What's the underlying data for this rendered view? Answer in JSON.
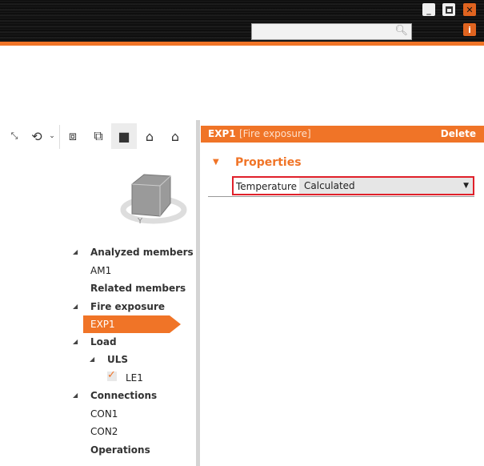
{
  "window": {
    "minimize_icon": "minimize-icon",
    "maximize_icon": "maximize-icon",
    "close_icon": "close-icon",
    "info_label": "i"
  },
  "search": {
    "placeholder": "",
    "value": ""
  },
  "toolbar": {
    "icons": [
      "zoom-extents-icon",
      "rotate-icon",
      "wireframe-view-icon",
      "transparent-view-icon",
      "solid-view-icon",
      "section-view-icon",
      "home-view-icon"
    ]
  },
  "tree": [
    {
      "label": "Analyzed members",
      "bold": true,
      "expander": true
    },
    {
      "label": "AM1"
    },
    {
      "label": "Related members",
      "bold": true
    },
    {
      "label": "Fire exposure",
      "bold": true,
      "expander": true
    },
    {
      "label": "EXP1",
      "selected": true
    },
    {
      "label": "Load",
      "bold": true,
      "expander": true
    },
    {
      "label": "ULS",
      "bold": true,
      "expander": true
    },
    {
      "label": "LE1",
      "checked": true
    },
    {
      "label": "Connections",
      "bold": true,
      "expander": true
    },
    {
      "label": "CON1"
    },
    {
      "label": "CON2"
    },
    {
      "label": "Operations",
      "bold": true
    }
  ],
  "detail": {
    "name": "EXP1",
    "type": "[Fire exposure]",
    "delete_label": "Delete",
    "section": "Properties",
    "property": {
      "label": "Temperature",
      "value": "Calculated"
    }
  },
  "colors": {
    "accent": "#f07427",
    "highlight": "#e0202a"
  }
}
